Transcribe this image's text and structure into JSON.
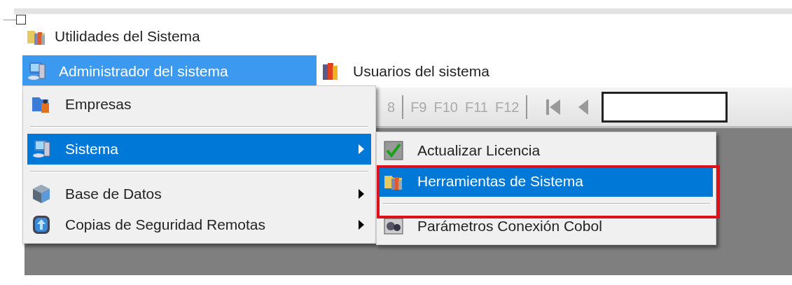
{
  "app_title": "Utilidades del Sistema",
  "menubar": [
    {
      "label": "Administrador del sistema",
      "selected": true
    },
    {
      "label": "Usuarios del sistema",
      "selected": false
    }
  ],
  "toolbar": {
    "keys": [
      "8",
      "F9",
      "F10",
      "F11",
      "F12"
    ]
  },
  "menu": [
    {
      "kind": "item",
      "label": "Empresas",
      "selected": false,
      "has_submenu": false
    },
    {
      "kind": "separator"
    },
    {
      "kind": "item",
      "label": "Sistema",
      "selected": true,
      "has_submenu": true
    },
    {
      "kind": "separator"
    },
    {
      "kind": "item",
      "label": "Base de Datos",
      "selected": false,
      "has_submenu": true
    },
    {
      "kind": "item",
      "label": "Copias de Seguridad Remotas",
      "selected": false,
      "has_submenu": true
    }
  ],
  "submenu": [
    {
      "kind": "item",
      "label": "Actualizar Licencia",
      "selected": false
    },
    {
      "kind": "item",
      "label": "Herramientas de Sistema",
      "selected": true
    },
    {
      "kind": "separator"
    },
    {
      "kind": "item",
      "label": "Parámetros Conexión Cobol",
      "selected": false
    }
  ]
}
